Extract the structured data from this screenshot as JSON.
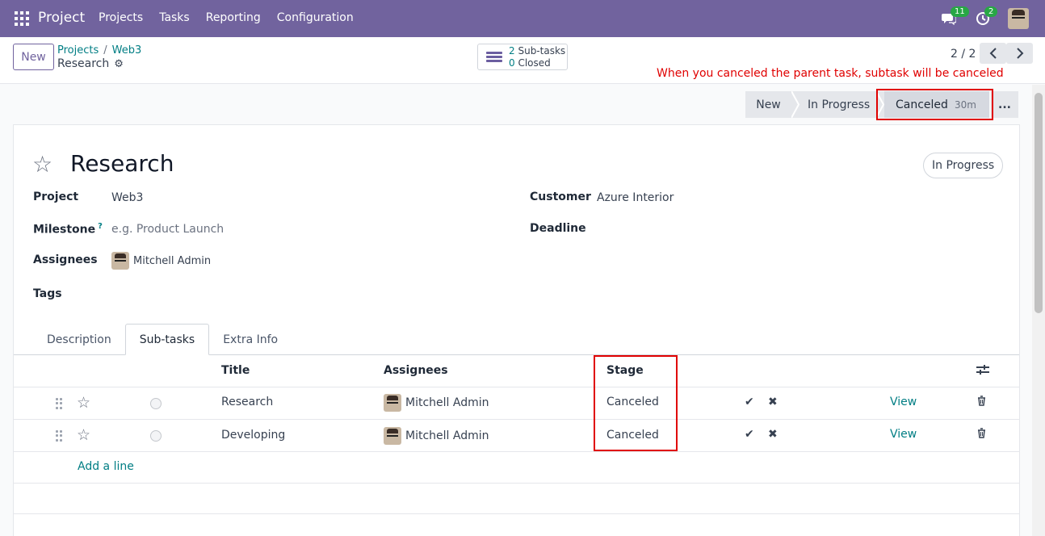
{
  "navbar": {
    "brand": "Project",
    "menu": [
      "Projects",
      "Tasks",
      "Reporting",
      "Configuration"
    ],
    "messages_badge": "11",
    "activities_badge": "2"
  },
  "control": {
    "new_label": "New",
    "breadcrumb": [
      "Projects",
      "Web3"
    ],
    "breadcrumb_sep": "/",
    "current": "Research",
    "subtasks_count": "2",
    "subtasks_label": "Sub-tasks",
    "closed_count": "0",
    "closed_label": "Closed",
    "pager": "2 / 2"
  },
  "annotation": "When you canceled the parent task, subtask will be canceled",
  "statusbar": {
    "stages": [
      "New",
      "In Progress",
      "Canceled"
    ],
    "active_duration": "30m",
    "more": "..."
  },
  "form": {
    "title": "Research",
    "state": "In Progress",
    "project_label": "Project",
    "project_value": "Web3",
    "milestone_label": "Milestone",
    "milestone_help": "?",
    "milestone_placeholder": "e.g. Product Launch",
    "assignees_label": "Assignees",
    "assignee": "Mitchell Admin",
    "tags_label": "Tags",
    "customer_label": "Customer",
    "customer_value": "Azure Interior",
    "deadline_label": "Deadline"
  },
  "tabs": [
    "Description",
    "Sub-tasks",
    "Extra Info"
  ],
  "table": {
    "headers": [
      "Title",
      "Assignees",
      "Stage"
    ],
    "rows": [
      {
        "title": "Research",
        "assignee": "Mitchell Admin",
        "stage": "Canceled",
        "view": "View"
      },
      {
        "title": "Developing",
        "assignee": "Mitchell Admin",
        "stage": "Canceled",
        "view": "View"
      }
    ],
    "add_line": "Add a line"
  },
  "colors": {
    "navbar": "#71639e",
    "link": "#017e84",
    "annotation": "#e00000"
  }
}
